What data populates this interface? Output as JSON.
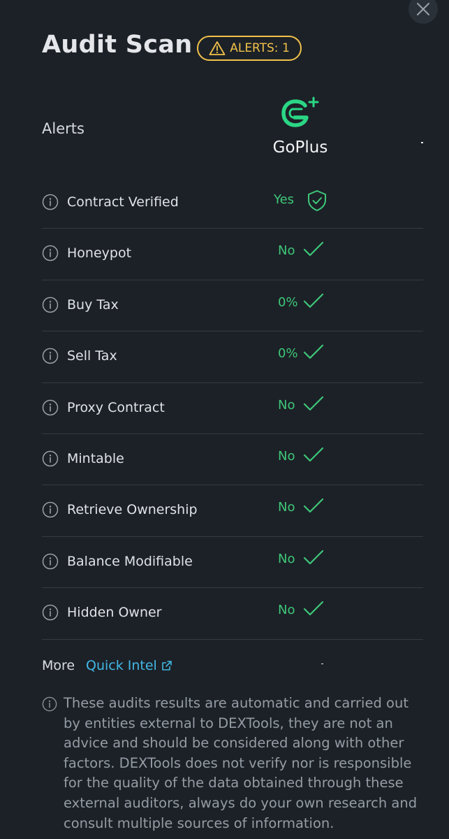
{
  "header": {
    "title": "Audit Scan",
    "alerts_badge": "ALERTS: 1"
  },
  "table": {
    "alerts_header": "Alerts",
    "provider_name": "GoPlus",
    "rows": [
      {
        "label": "Contract Verified",
        "value": "Yes",
        "icon": "shield-check-icon"
      },
      {
        "label": "Honeypot",
        "value": "No",
        "icon": "check-icon"
      },
      {
        "label": "Buy Tax",
        "value": "0%",
        "icon": "check-icon"
      },
      {
        "label": "Sell Tax",
        "value": "0%",
        "icon": "check-icon"
      },
      {
        "label": "Proxy Contract",
        "value": "No",
        "icon": "check-icon"
      },
      {
        "label": "Mintable",
        "value": "No",
        "icon": "check-icon"
      },
      {
        "label": "Retrieve Ownership",
        "value": "No",
        "icon": "check-icon"
      },
      {
        "label": "Balance Modifiable",
        "value": "No",
        "icon": "check-icon"
      },
      {
        "label": "Hidden Owner",
        "value": "No",
        "icon": "check-icon"
      }
    ]
  },
  "more": {
    "label": "More",
    "link_text": "Quick Intel"
  },
  "disclaimer": "These audits results are automatic and carried out by entities external to DEXTools, they are not an advice and should be considered along with other factors. DEXTools does not verify nor is responsible for the quality of the data obtained through these external auditors, always do your own research and consult multiple sources of information.",
  "colors": {
    "background": "#1c2127",
    "accent_green": "#3ec779",
    "warning_yellow": "#f2c24a",
    "link_blue": "#42b7e6",
    "divider": "#343b43",
    "muted_text": "#959ca5"
  }
}
